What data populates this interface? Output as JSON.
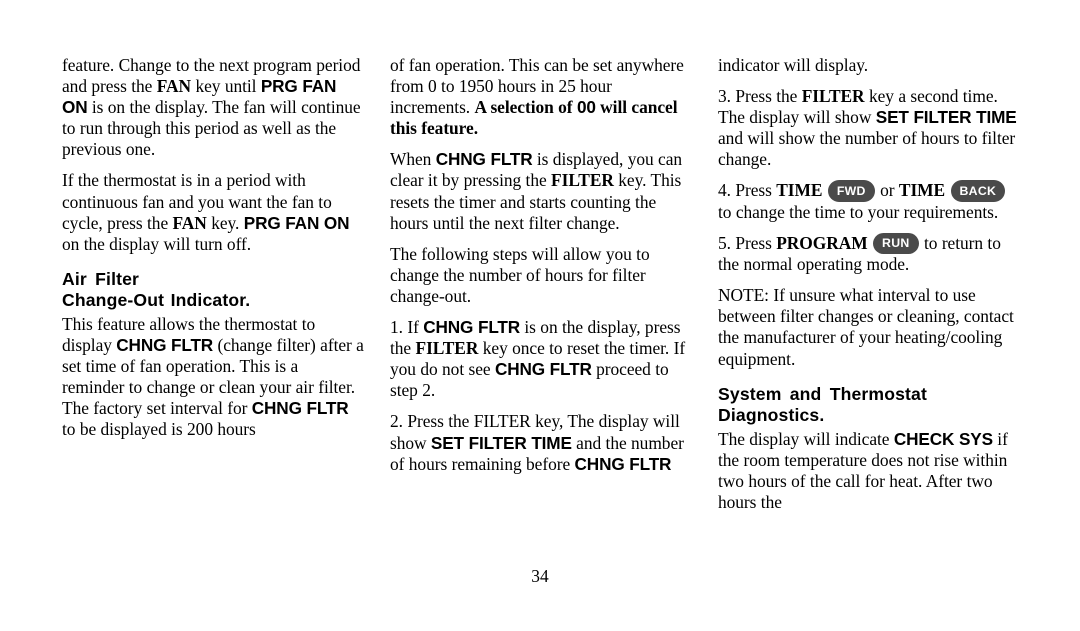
{
  "document": {
    "page_number": "34",
    "badge_color": "#4a4a4a",
    "badge_text_color": "#ffffff",
    "page_background": "#ffffff",
    "text_color": "#000000"
  },
  "column1": {
    "para1": {
      "s1": "feature. Change to the next program period and press the ",
      "key_fan": "FAN",
      "s2": " key until ",
      "lcd_prg_fan_on": "PRG FAN ON",
      "s3": " is on the display. The fan will continue to run through this period as well as the previous one."
    },
    "para2": {
      "s1": "If the thermostat is in a period with continuous fan and you want the fan to cycle, press the ",
      "key_fan": "FAN",
      "s2": " key. ",
      "lcd_prg_fan_on": "PRG FAN ON",
      "s3": " on the display will turn off."
    },
    "heading": {
      "line1": "Air Filter",
      "line2": "Change-Out Indicator."
    },
    "para3": {
      "s1": "This feature allows the thermostat to display ",
      "lcd_chng_fltr": "CHNG FLTR",
      "s2": " (change filter) after a set time of fan operation. This is a reminder to change or clean your air filter. The factory set interval for ",
      "lcd_chng_fltr2": "CHNG FLTR",
      "s3": " to be displayed is 200 hours"
    }
  },
  "column2": {
    "para1": {
      "s1": "of fan operation. This can be set anywhere from 0 to 1950 hours in 25 hour increments. ",
      "bold_serif_1": "A selection of ",
      "bold_sans_00": "00",
      "bold_serif_2": " will cancel this feature."
    },
    "para2": {
      "s1": "When ",
      "lcd_chng_fltr": "CHNG FLTR",
      "s2": " is displayed, you can clear it by pressing the ",
      "key_filter": "FILTER",
      "s3": " key. This resets the timer and starts counting the hours until the next filter change."
    },
    "para3": {
      "s1": "The following steps will allow you to change the number of hours for filter change-out."
    },
    "step1": {
      "s1": "1. If ",
      "lcd_chng_fltr": "CHNG FLTR",
      "s2": " is on the display, press the ",
      "key_filter": "FILTER",
      "s3": " key once to reset the timer. If you do not see ",
      "lcd_chng_fltr2": "CHNG FLTR",
      "s4": " proceed to step 2."
    },
    "step2": {
      "s1": "2. Press the FILTER key, The display will show ",
      "lcd_set_filter_time": "SET FILTER TIME",
      "s2": " and the number of hours remaining before ",
      "lcd_chng_fltr": "CHNG FLTR"
    }
  },
  "column3": {
    "para1": {
      "s1": "indicator will display."
    },
    "step3": {
      "s1": "3. Press the ",
      "key_filter": "FILTER",
      "s2": " key a second time. The display will show ",
      "lcd_set_filter_time": "SET FILTER TIME",
      "s3": " and will show the number of hours to filter change."
    },
    "step4": {
      "s1": "4. Press ",
      "key_time_1": "TIME",
      "badge_fwd": "FWD",
      "s2": " or ",
      "key_time_2": "TIME",
      "badge_back": "BACK",
      "s3": " to change the time to your requirements."
    },
    "step5": {
      "s1": "5. Press ",
      "key_program": "PROGRAM",
      "badge_run": "RUN",
      "s2": " to return to the normal operating mode."
    },
    "note": {
      "s1": "NOTE: If unsure what interval to use between filter changes or cleaning, contact the manufacturer of your heating/cooling equipment."
    },
    "heading": {
      "line1": "System and Thermostat",
      "line2": "Diagnostics."
    },
    "para_last": {
      "s1": "The display will indicate ",
      "lcd_check_sys": "CHECK SYS",
      "s2": " if the room temperature does not rise within two hours of the call for heat. After two hours the"
    }
  }
}
